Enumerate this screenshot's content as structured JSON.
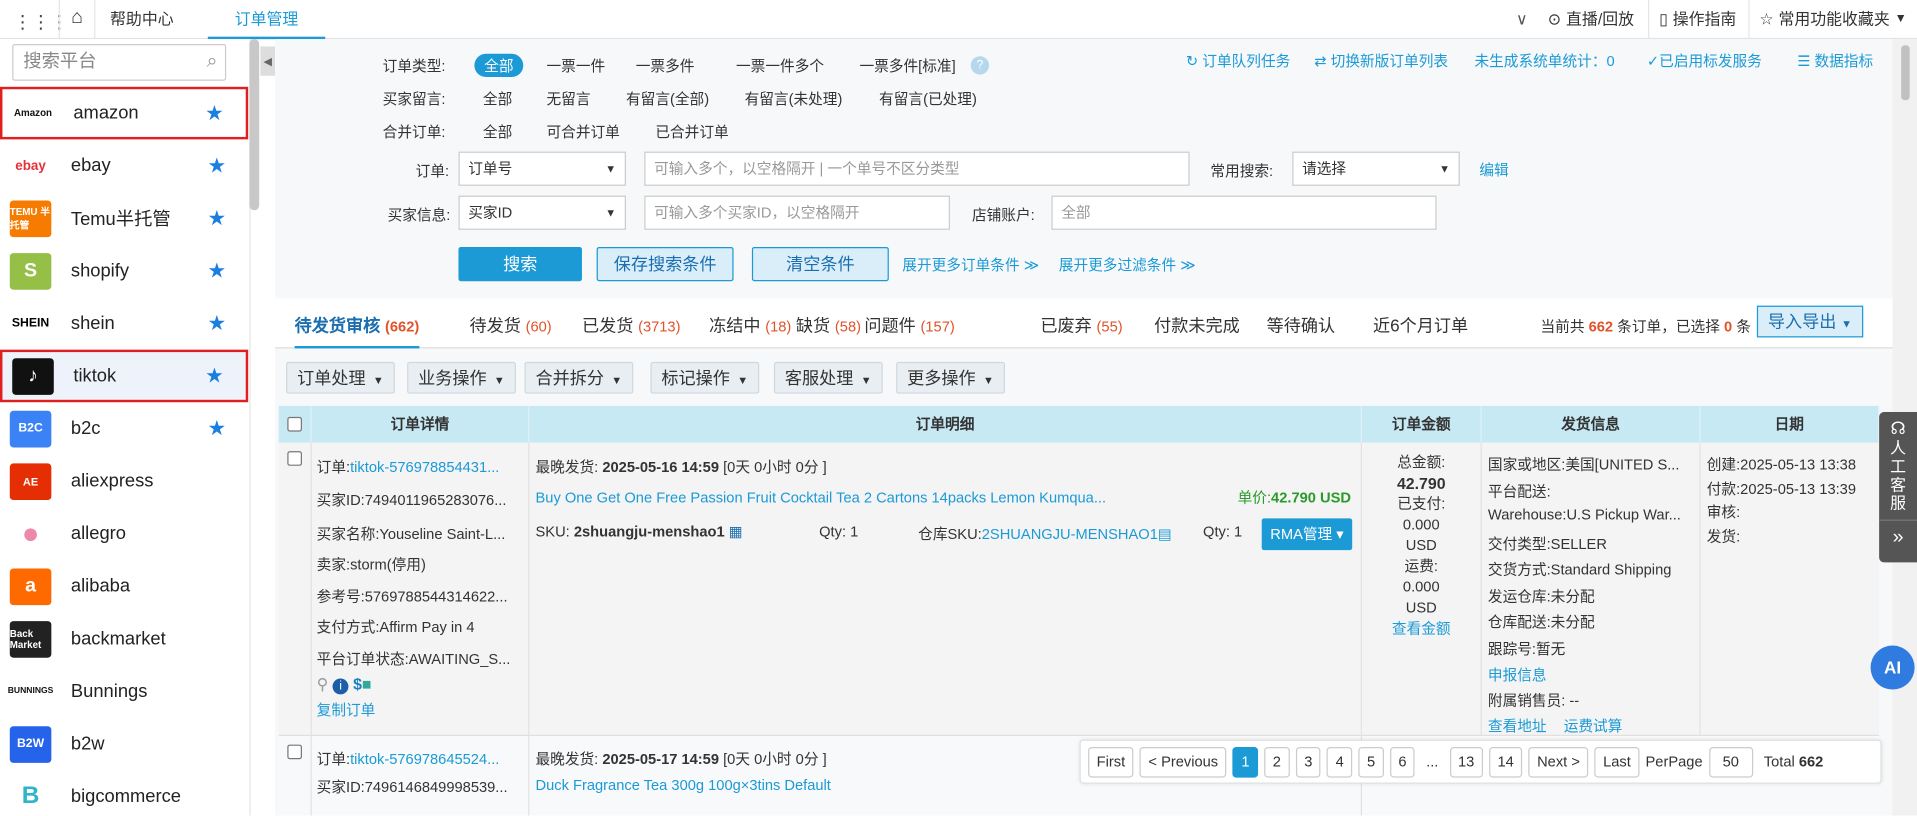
{
  "topbar": {
    "tabs": [
      "帮助中心",
      "订单管理"
    ],
    "right": {
      "live": "直播/回放",
      "guide": "操作指南",
      "favorites": "常用功能收藏夹"
    }
  },
  "sidebar": {
    "search_placeholder": "搜索平台",
    "platforms": [
      {
        "name": "amazon",
        "logo": "Amazon",
        "starred": true
      },
      {
        "name": "ebay",
        "logo": "ebay",
        "starred": true
      },
      {
        "name": "Temu半托管",
        "logo": "TEMU 半托管",
        "starred": true
      },
      {
        "name": "shopify",
        "logo": "S",
        "starred": true
      },
      {
        "name": "shein",
        "logo": "SHEIN",
        "starred": true
      },
      {
        "name": "tiktok",
        "logo": "♪",
        "starred": true
      },
      {
        "name": "b2c",
        "logo": "B2C",
        "starred": true
      },
      {
        "name": "aliexpress",
        "logo": "AE",
        "starred": false
      },
      {
        "name": "allegro",
        "logo": "●",
        "starred": false
      },
      {
        "name": "alibaba",
        "logo": "a",
        "starred": false
      },
      {
        "name": "backmarket",
        "logo": "Back Market",
        "starred": false
      },
      {
        "name": "Bunnings",
        "logo": "BUNNINGS",
        "starred": false
      },
      {
        "name": "b2w",
        "logo": "B2W",
        "starred": false
      },
      {
        "name": "bigcommerce",
        "logo": "B",
        "starred": false
      }
    ]
  },
  "filters": {
    "order_type": {
      "label": "订单类型:",
      "options": [
        "全部",
        "一票一件",
        "一票多件",
        "一票一件多个",
        "一票多件[标准]"
      ]
    },
    "buyer_msg": {
      "label": "买家留言:",
      "options": [
        "全部",
        "无留言",
        "有留言(全部)",
        "有留言(未处理)",
        "有留言(已处理)"
      ]
    },
    "merge": {
      "label": "合并订单:",
      "options": [
        "全部",
        "可合并订单",
        "已合并订单"
      ]
    },
    "order": {
      "label": "订单:",
      "select": "订单号",
      "placeholder": "可输入多个，以空格隔开 | 一个单号不区分类型"
    },
    "common_search": {
      "label": "常用搜索:",
      "select": "请选择",
      "edit": "编辑"
    },
    "buyer": {
      "label": "买家信息:",
      "select": "买家ID",
      "placeholder": "可输入多个买家ID，以空格隔开"
    },
    "store": {
      "label": "店铺账户:",
      "placeholder": "全部"
    },
    "buttons": {
      "search": "搜索",
      "save": "保存搜索条件",
      "clear": "清空条件",
      "more_order": "展开更多订单条件 ≫",
      "more_filter": "展开更多过滤条件 ≫"
    },
    "links": {
      "queue": "订单队列任务",
      "switch": "切换新版订单列表",
      "unsync": "未生成系统单统计：0",
      "service": "已启用标发服务",
      "metrics": "数据指标"
    }
  },
  "tabs": [
    {
      "label": "待发货审核",
      "count": "(662)"
    },
    {
      "label": "待发货",
      "count": "(60)"
    },
    {
      "label": "已发货",
      "count": "(3713)"
    },
    {
      "label": "冻结中",
      "count": "(18)"
    },
    {
      "label": "缺货",
      "count": "(58)"
    },
    {
      "label": "问题件",
      "count": "(157)"
    },
    {
      "label": "已废弃",
      "count": "(55)"
    },
    {
      "label": "付款未完成",
      "count": ""
    },
    {
      "label": "等待确认",
      "count": ""
    },
    {
      "label": "近6个月订单",
      "count": ""
    }
  ],
  "summary": {
    "prefix": "当前共",
    "total": "662",
    "mid": "条订单，已选择",
    "selected": "0",
    "suffix": "条",
    "export": "导入导出"
  },
  "actions": [
    "订单处理",
    "业务操作",
    "合并拆分",
    "标记操作",
    "客服处理",
    "更多操作"
  ],
  "table": {
    "headers": [
      "订单详情",
      "订单明细",
      "订单金额",
      "发货信息",
      "日期"
    ],
    "rows": [
      {
        "order_label": "订单:",
        "order_id": "tiktok-576978854431...",
        "buyer_id": "买家ID:7494011965283076...",
        "buyer_name": "买家名称:Youseline Saint-L...",
        "seller": "卖家:storm(停用)",
        "ref": "参考号:5769788544314622...",
        "payment": "支付方式:Affirm Pay in 4",
        "status": "平台订单状态:AWAITING_S...",
        "copy": "复制订单",
        "ship_label": "最晚发货:",
        "ship_date": "2025-05-16 14:59",
        "ship_remain": "[0天 0小时 0分 ]",
        "product": "Buy One Get One Free Passion Fruit Cocktail Tea 2 Cartons 14packs Lemon Kumqua...",
        "sku_label": "SKU:",
        "sku": "2shuangju-menshao1",
        "qty": "Qty: 1",
        "wh_sku_label": "仓库SKU:",
        "wh_sku": "2SHUANGJU-MENSHAO1",
        "wh_qty": "Qty: 1",
        "unit_label": "单价:",
        "unit_price": "42.790 USD",
        "rma": "RMA管理",
        "amount": [
          "总金额:",
          "42.790",
          "已支付:",
          "0.000",
          "USD",
          "运费:",
          "0.000",
          "USD"
        ],
        "view_amount": "查看金额",
        "shipping": [
          "国家或地区:美国[UNITED S...",
          "平台配送:",
          "Warehouse:U.S Pickup War...",
          "交付类型:SELLER",
          "交货方式:Standard Shipping",
          "发运仓库:未分配",
          "仓库配送:未分配",
          "跟踪号:暂无"
        ],
        "declare": "申报信息",
        "salesman": "附属销售员: --",
        "view_addr": "查看地址",
        "freight": "运费试算",
        "dates": [
          "创建:2025-05-13 13:38",
          "付款:2025-05-13 13:39",
          "审核:",
          "发货:"
        ]
      },
      {
        "order_label": "订单:",
        "order_id": "tiktok-576978645524...",
        "buyer_id": "买家ID:7496146849998539...",
        "ship_label": "最晚发货:",
        "ship_date": "2025-05-17 14:59",
        "ship_remain": "[0天 0小时 0分 ]",
        "product": "Duck Fragrance Tea 300g 100g×3tins Default"
      }
    ]
  },
  "pagination": {
    "first": "First",
    "prev": "< Previous",
    "pages": [
      "1",
      "2",
      "3",
      "4",
      "5",
      "6",
      "...",
      "13",
      "14"
    ],
    "current": "1",
    "next": "Next >",
    "last": "Last",
    "per_page_label": "PerPage",
    "per_page": "50",
    "total_label": "Total",
    "total": "662"
  },
  "float": {
    "service": "人工客服",
    "expand": "»",
    "ai": "AI"
  }
}
